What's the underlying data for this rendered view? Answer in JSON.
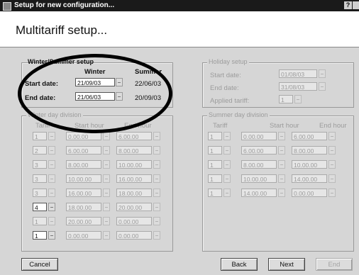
{
  "window": {
    "title": "Setup for new configuration...",
    "help_glyph": "?"
  },
  "header": {
    "title": "Multitariff setup..."
  },
  "winter_summer": {
    "legend": "Winter/Summer setup",
    "col_winter": "Winter",
    "col_summer": "Summer",
    "start_label": "Start date:",
    "end_label": "End date:",
    "winter_start": "21/09/03",
    "summer_start": "22/06/03",
    "winter_end": "21/06/03",
    "summer_end": "20/09/03"
  },
  "holiday": {
    "legend": "Holiday setup",
    "start_label": "Start date:",
    "end_label": "End date:",
    "tariff_label": "Applied tariff:",
    "start_value": "01/08/03",
    "end_value": "31/08/03",
    "tariff_value": "1"
  },
  "winter_day": {
    "legend": "Winter day division",
    "col_tariff": "Tariff",
    "col_start": "Start hour",
    "col_end": "End hour",
    "rows": [
      {
        "tariff": "1",
        "start": "0.00.00",
        "end": "6.00.00"
      },
      {
        "tariff": "2",
        "start": "6.00.00",
        "end": "8.00.00"
      },
      {
        "tariff": "3",
        "start": "8.00.00",
        "end": "10.00.00"
      },
      {
        "tariff": "3",
        "start": "10.00.00",
        "end": "16.00.00"
      },
      {
        "tariff": "3",
        "start": "16.00.00",
        "end": "18.00.00"
      },
      {
        "tariff": "4",
        "start": "18.00.00",
        "end": "20.00.00"
      },
      {
        "tariff": "1",
        "start": "20.00.00",
        "end": "0.00.00"
      },
      {
        "tariff": "1",
        "start": "0.00.00",
        "end": "0.00.00"
      }
    ]
  },
  "summer_day": {
    "legend": "Summer day division",
    "col_tariff": "Tariff",
    "col_start": "Start hour",
    "col_end": "End hour",
    "rows": [
      {
        "tariff": "1",
        "start": "0.00.00",
        "end": "6.00.00"
      },
      {
        "tariff": "1",
        "start": "6.00.00",
        "end": "8.00.00"
      },
      {
        "tariff": "1",
        "start": "8.00.00",
        "end": "10.00.00"
      },
      {
        "tariff": "1",
        "start": "10.00.00",
        "end": "14.00.00"
      },
      {
        "tariff": "1",
        "start": "14.00.00",
        "end": "0.00.00"
      }
    ]
  },
  "footer": {
    "cancel": "Cancel",
    "back": "Back",
    "next": "Next",
    "end": "End"
  }
}
